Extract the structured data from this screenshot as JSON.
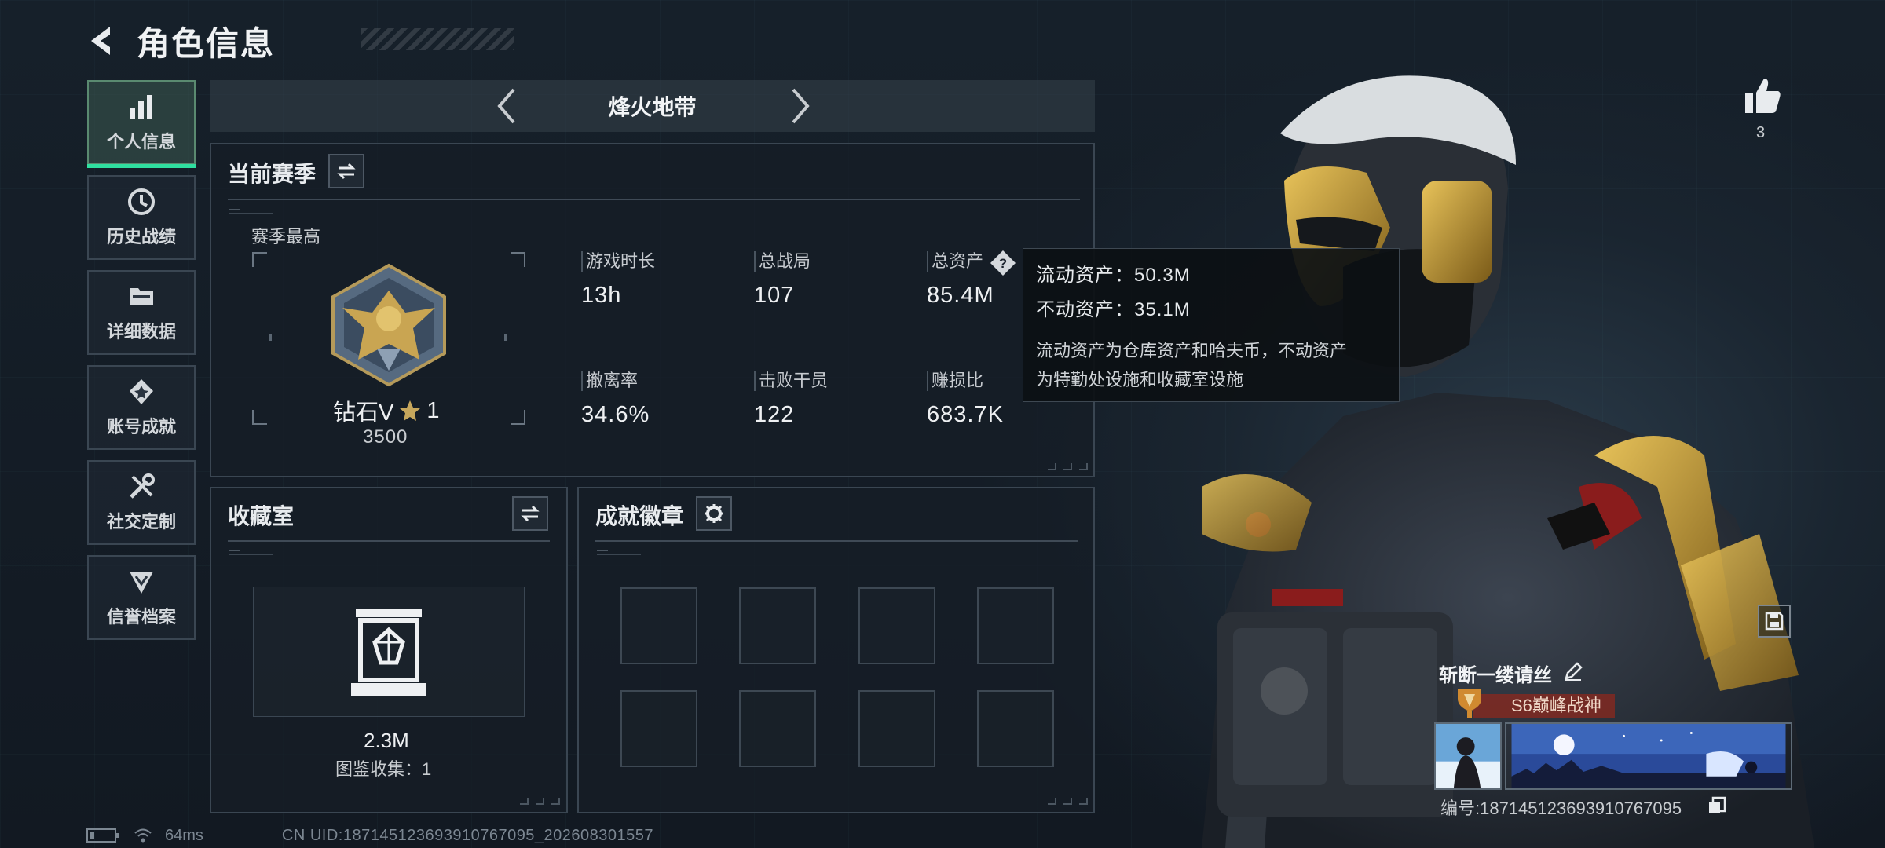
{
  "header": {
    "title": "角色信息"
  },
  "sidebar": {
    "items": [
      {
        "label": "个人信息",
        "icon": "bar-chart-icon",
        "active": true
      },
      {
        "label": "历史战绩",
        "icon": "history-clock-icon"
      },
      {
        "label": "详细数据",
        "icon": "folder-icon"
      },
      {
        "label": "账号成就",
        "icon": "achievement-medal-icon"
      },
      {
        "label": "社交定制",
        "icon": "tools-wrench-icon"
      },
      {
        "label": "信誉档案",
        "icon": "shield-chevron-icon"
      }
    ]
  },
  "mode": {
    "title": "烽火地带"
  },
  "season": {
    "title": "当前赛季",
    "best_label": "赛季最高",
    "rank_name": "钻石V",
    "rank_stars": "1",
    "rank_score": "3500",
    "stats": [
      {
        "label": "游戏时长",
        "value": "13h"
      },
      {
        "label": "总战局",
        "value": "107"
      },
      {
        "label": "总资产",
        "value": "85.4M"
      },
      {
        "label": "撤离率",
        "value": "34.6%"
      },
      {
        "label": "击败干员",
        "value": "122"
      },
      {
        "label": "赚损比",
        "value": "683.7K"
      }
    ]
  },
  "tooltip": {
    "liquid": "流动资产：50.3M",
    "fixed": "不动资产：35.1M",
    "desc_line1": "流动资产为仓库资产和哈夫币，不动资产",
    "desc_line2": "为特勤处设施和收藏室设施"
  },
  "vault": {
    "title": "收藏室",
    "value": "2.3M",
    "collection": "图鉴收集：1"
  },
  "badges": {
    "title": "成就徽章",
    "slots": 8
  },
  "likes": {
    "count": "3"
  },
  "player": {
    "name": "斩断一缕请丝",
    "rank_tag": "S6巅峰战神",
    "id": "编号:18714512369391076709​5"
  },
  "status": {
    "ping": "64ms",
    "uid": "CN UID:18714512369391076709​5_202608301557"
  },
  "colors": {
    "accent": "#2fe0a0",
    "panel_border": "#3a4652",
    "tag_red": "#8c281e"
  }
}
